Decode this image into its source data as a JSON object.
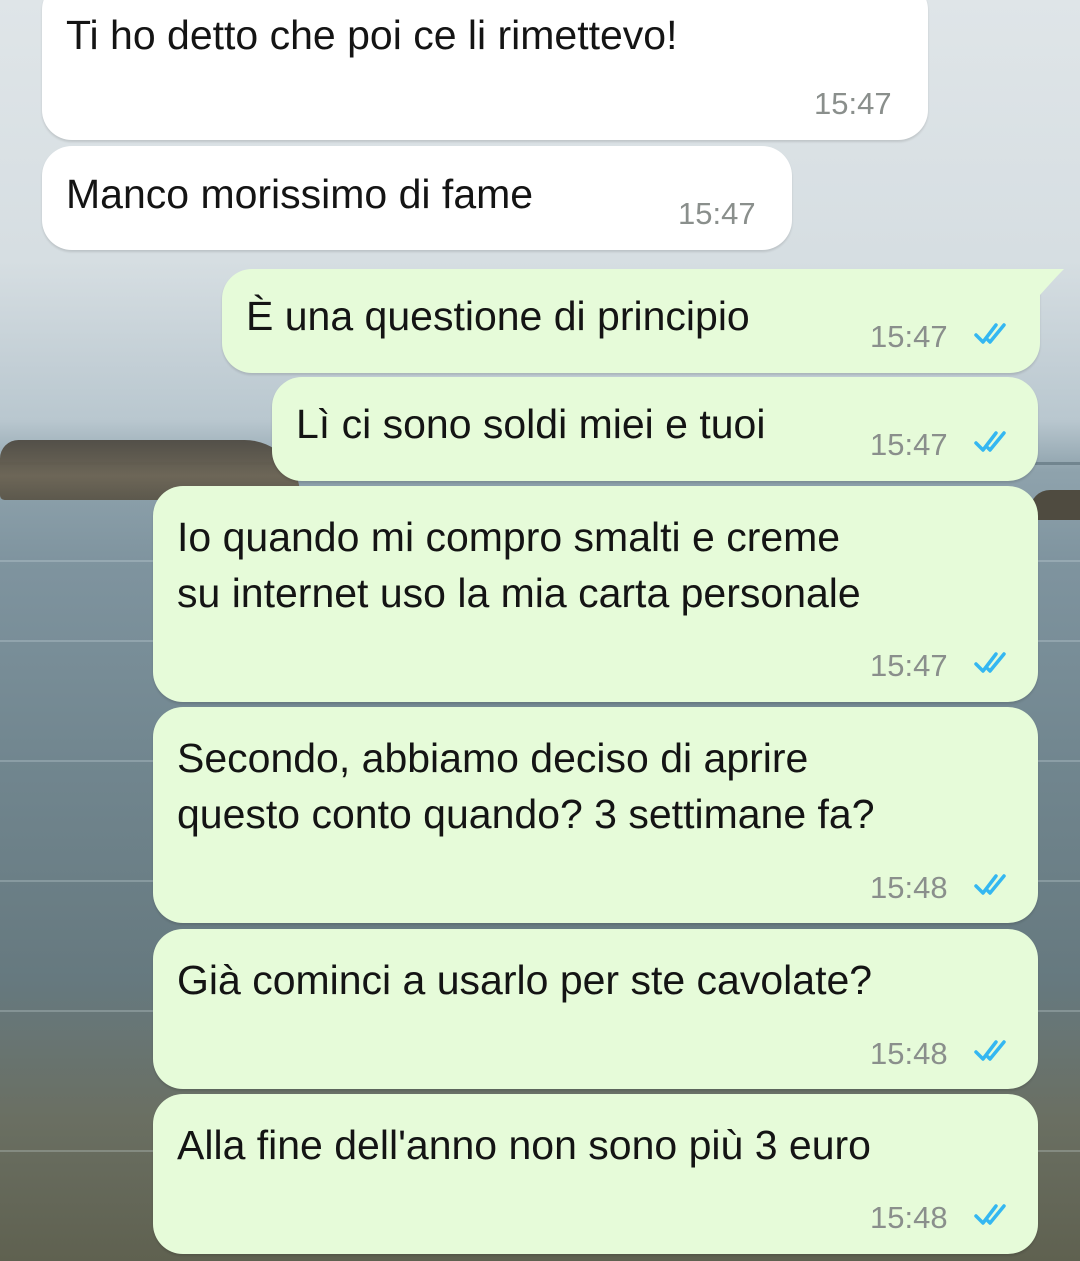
{
  "wallpaper": {
    "description": "sea photo background"
  },
  "messages": [
    {
      "direction": "incoming",
      "text": "Ti ho detto che poi ce li rimettevo!",
      "time": "15:47"
    },
    {
      "direction": "incoming",
      "text": "Manco morissimo di fame",
      "time": "15:47"
    },
    {
      "direction": "outgoing",
      "text": "È una questione di principio",
      "time": "15:47",
      "status": "read"
    },
    {
      "direction": "outgoing",
      "text": "Lì ci sono soldi miei e tuoi",
      "time": "15:47",
      "status": "read"
    },
    {
      "direction": "outgoing",
      "lines": [
        "Io quando mi compro smalti e creme",
        "su internet uso la mia carta personale"
      ],
      "time": "15:47",
      "status": "read"
    },
    {
      "direction": "outgoing",
      "lines": [
        "Secondo, abbiamo deciso di aprire",
        "questo conto quando? 3 settimane fa?"
      ],
      "time": "15:48",
      "status": "read"
    },
    {
      "direction": "outgoing",
      "text": "Già cominci a usarlo per ste cavolate?",
      "time": "15:48",
      "status": "read"
    },
    {
      "direction": "outgoing",
      "text": "Alla fine dell'anno non sono più 3 euro",
      "time": "15:48",
      "status": "read"
    }
  ],
  "colors": {
    "incoming_bubble": "#ffffff",
    "outgoing_bubble": "#e6fbd9",
    "read_ticks": "#34b7f1",
    "timestamp": "#8a8f8c"
  },
  "icons": {
    "read_receipt": "double-check-icon"
  }
}
